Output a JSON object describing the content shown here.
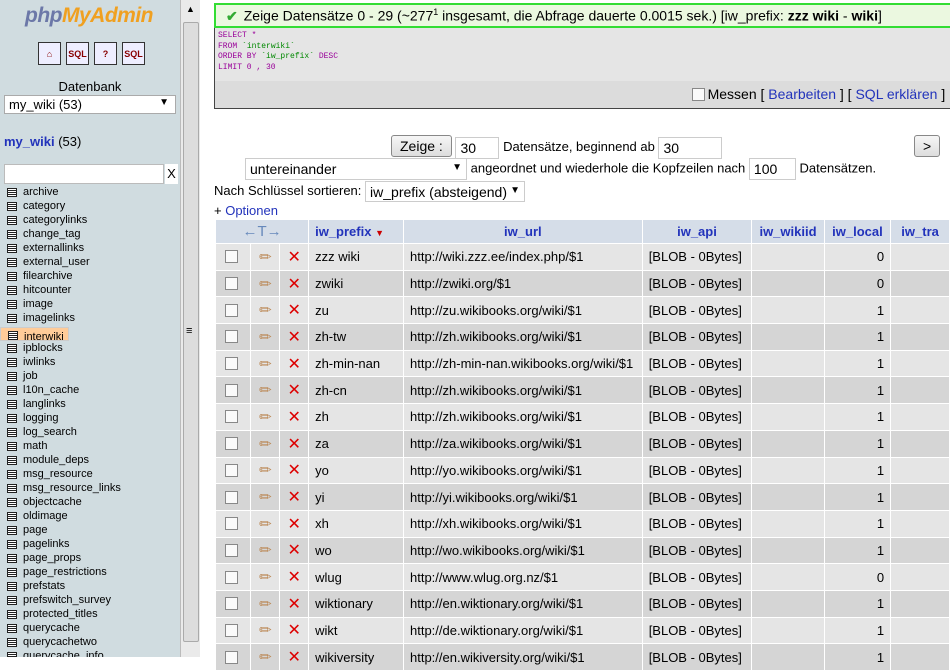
{
  "sidebar": {
    "logo": {
      "php": "php",
      "myadmin": "MyAdmin"
    },
    "icons": [
      "home-icon",
      "sql-query-icon",
      "help-icon",
      "sql-docs-icon"
    ],
    "database_label": "Datenbank",
    "database_select": "my_wiki (53)",
    "db_name": "my_wiki",
    "db_count": "(53)",
    "filter_value": "",
    "filter_clear": "X",
    "tables": [
      "archive",
      "category",
      "categorylinks",
      "change_tag",
      "externallinks",
      "external_user",
      "filearchive",
      "hitcounter",
      "image",
      "imagelinks",
      "interwiki",
      "ipblocks",
      "iwlinks",
      "job",
      "l10n_cache",
      "langlinks",
      "logging",
      "log_search",
      "math",
      "module_deps",
      "msg_resource",
      "msg_resource_links",
      "objectcache",
      "oldimage",
      "page",
      "pagelinks",
      "page_props",
      "page_restrictions",
      "prefstats",
      "prefswitch_survey",
      "protected_titles",
      "querycache",
      "querycachetwo",
      "querycache_info"
    ],
    "selected_table": "interwiki"
  },
  "message": {
    "pre": "Zeige Datensätze 0 - 29 (~277",
    "sup": "1",
    "mid": " insgesamt, die Abfrage dauerte 0.0015 sek.) [iw_prefix: ",
    "b1": "zzz wiki",
    "dash": " - ",
    "b2": "wiki",
    "end": "]"
  },
  "sql": {
    "l1": "SELECT *",
    "l2a": "FROM ",
    "l2b": "`interwiki`",
    "l3a": "ORDER BY ",
    "l3b": "`iw_prefix`",
    "l3c": " DESC",
    "l4": "LIMIT 0 , 30"
  },
  "sqlbar": {
    "measure": "Messen",
    "b1": " [ ",
    "edit": "Bearbeiten",
    "b2": " ] [ ",
    "explain": "SQL erklären",
    "b3": " ] ["
  },
  "nav": {
    "show": "Zeige :",
    "count": "30",
    "records_from": "Datensätze, beginnend ab",
    "start": "30",
    "next": ">",
    "mode": "untereinander",
    "repeat_text": "angeordnet und wiederhole die Kopfzeilen nach",
    "repeat": "100",
    "records": "Datensätzen.",
    "sort_label": "Nach Schlüssel sortieren:",
    "sort_value": "iw_prefix (absteigend)",
    "options": "Optionen",
    "plus": "+ "
  },
  "table": {
    "arrows": "←T→",
    "columns": [
      "iw_prefix",
      "iw_url",
      "iw_api",
      "iw_wikiid",
      "iw_local",
      "iw_tra"
    ],
    "rows": [
      [
        "zzz wiki",
        "http://wiki.zzz.ee/index.php/$1",
        "[BLOB - 0Bytes]",
        "",
        "0"
      ],
      [
        "zwiki",
        "http://zwiki.org/$1",
        "[BLOB - 0Bytes]",
        "",
        "0"
      ],
      [
        "zu",
        "http://zu.wikibooks.org/wiki/$1",
        "[BLOB - 0Bytes]",
        "",
        "1"
      ],
      [
        "zh-tw",
        "http://zh.wikibooks.org/wiki/$1",
        "[BLOB - 0Bytes]",
        "",
        "1"
      ],
      [
        "zh-min-nan",
        "http://zh-min-nan.wikibooks.org/wiki/$1",
        "[BLOB - 0Bytes]",
        "",
        "1"
      ],
      [
        "zh-cn",
        "http://zh.wikibooks.org/wiki/$1",
        "[BLOB - 0Bytes]",
        "",
        "1"
      ],
      [
        "zh",
        "http://zh.wikibooks.org/wiki/$1",
        "[BLOB - 0Bytes]",
        "",
        "1"
      ],
      [
        "za",
        "http://za.wikibooks.org/wiki/$1",
        "[BLOB - 0Bytes]",
        "",
        "1"
      ],
      [
        "yo",
        "http://yo.wikibooks.org/wiki/$1",
        "[BLOB - 0Bytes]",
        "",
        "1"
      ],
      [
        "yi",
        "http://yi.wikibooks.org/wiki/$1",
        "[BLOB - 0Bytes]",
        "",
        "1"
      ],
      [
        "xh",
        "http://xh.wikibooks.org/wiki/$1",
        "[BLOB - 0Bytes]",
        "",
        "1"
      ],
      [
        "wo",
        "http://wo.wikibooks.org/wiki/$1",
        "[BLOB - 0Bytes]",
        "",
        "1"
      ],
      [
        "wlug",
        "http://www.wlug.org.nz/$1",
        "[BLOB - 0Bytes]",
        "",
        "0"
      ],
      [
        "wiktionary",
        "http://en.wiktionary.org/wiki/$1",
        "[BLOB - 0Bytes]",
        "",
        "1"
      ],
      [
        "wikt",
        "http://de.wiktionary.org/wiki/$1",
        "[BLOB - 0Bytes]",
        "",
        "1"
      ],
      [
        "wikiversity",
        "http://en.wikiversity.org/wiki/$1",
        "[BLOB - 0Bytes]",
        "",
        "1"
      ]
    ]
  }
}
